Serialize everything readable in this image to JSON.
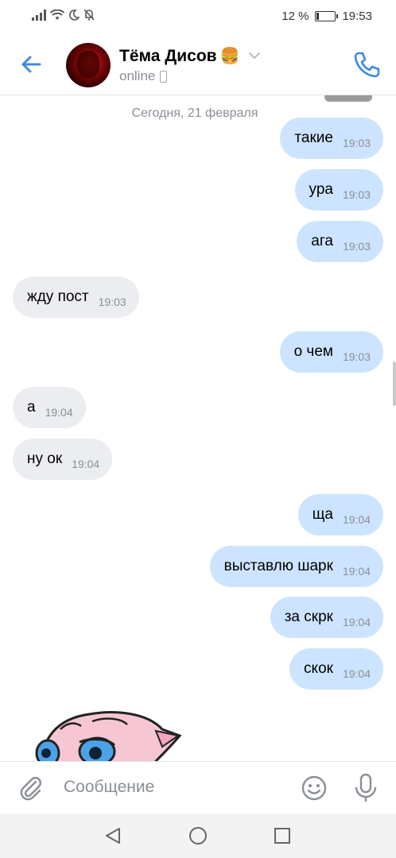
{
  "status_bar": {
    "battery_percent": "12 %",
    "battery_level": 0.12,
    "time": "19:53",
    "icons": [
      "signal-icon",
      "wifi-icon",
      "moon-icon",
      "bell-muted-icon"
    ]
  },
  "header": {
    "contact_name": "Тёма Дисов",
    "name_emoji": "🍔",
    "presence": "online",
    "icons": [
      "back-arrow-icon",
      "chevron-down-icon",
      "mobile-device-icon",
      "phone-call-icon"
    ]
  },
  "chat": {
    "date_separator": "Сегодня, 21 февраля",
    "messages": [
      {
        "dir": "out",
        "text": "такие",
        "time": "19:03"
      },
      {
        "dir": "out",
        "text": "ура",
        "time": "19:03"
      },
      {
        "dir": "out",
        "text": "ага",
        "time": "19:03"
      },
      {
        "dir": "in",
        "text": "жду пост",
        "time": "19:03"
      },
      {
        "dir": "out",
        "text": "о чем",
        "time": "19:03"
      },
      {
        "dir": "in",
        "text": "а",
        "time": "19:04"
      },
      {
        "dir": "in",
        "text": "ну ок",
        "time": "19:04"
      },
      {
        "dir": "out",
        "text": "ща",
        "time": "19:04"
      },
      {
        "dir": "out",
        "text": "выставлю шарк",
        "time": "19:04"
      },
      {
        "dir": "out",
        "text": "за скрк",
        "time": "19:04"
      },
      {
        "dir": "out",
        "text": "скок",
        "time": "19:04"
      }
    ]
  },
  "composer": {
    "placeholder": "Сообщение",
    "icons": [
      "attach-icon",
      "emoji-icon",
      "microphone-icon"
    ]
  },
  "colors": {
    "accent": "#3f8ae0",
    "outgoing_bubble": "#cce4ff",
    "incoming_bubble": "#ebedf0",
    "muted_text": "#8a8f96"
  }
}
